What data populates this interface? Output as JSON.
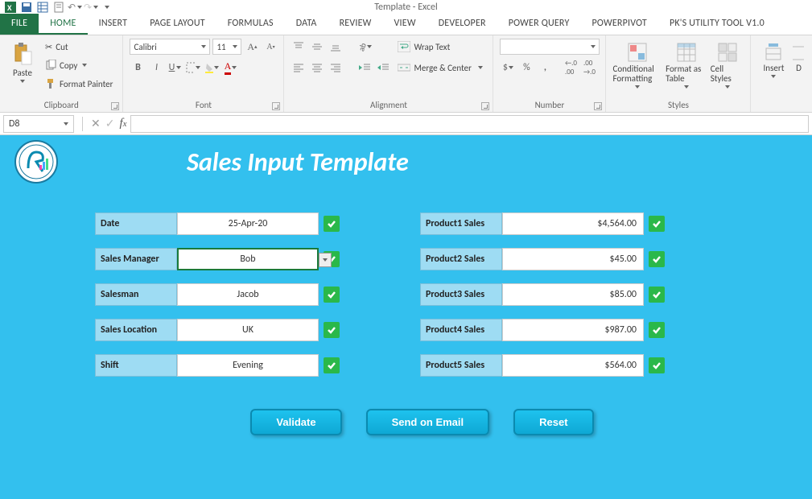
{
  "app": {
    "title": "Template - Excel"
  },
  "qat_icons": [
    "excel",
    "save",
    "table",
    "form",
    "undo",
    "redo"
  ],
  "tabs": [
    "FILE",
    "HOME",
    "INSERT",
    "PAGE LAYOUT",
    "FORMULAS",
    "DATA",
    "REVIEW",
    "VIEW",
    "DEVELOPER",
    "POWER QUERY",
    "POWERPIVOT",
    "PK's Utility Tool V1.0"
  ],
  "active_tab": "HOME",
  "ribbon": {
    "clipboard": {
      "paste": "Paste",
      "cut": "Cut",
      "copy": "Copy",
      "format_painter": "Format Painter",
      "label": "Clipboard"
    },
    "font": {
      "name": "Calibri",
      "size": "11",
      "label": "Font"
    },
    "alignment": {
      "wrap": "Wrap Text",
      "merge": "Merge & Center",
      "label": "Alignment"
    },
    "number": {
      "label": "Number"
    },
    "styles": {
      "cond": "Conditional Formatting",
      "fmt_table": "Format as Table",
      "cell_styles": "Cell Styles",
      "label": "Styles"
    },
    "cells": {
      "insert": "Insert",
      "delete": "D",
      "label": ""
    }
  },
  "formula_bar": {
    "cell_ref": "D8",
    "fx": ""
  },
  "sheet": {
    "title": "Sales Input Template",
    "left": [
      {
        "label": "Date",
        "value": "25-Apr-20",
        "check": true
      },
      {
        "label": "Sales Manager",
        "value": "Bob",
        "check": true,
        "selected": true,
        "dropdown": true
      },
      {
        "label": "Salesman",
        "value": "Jacob",
        "check": true
      },
      {
        "label": "Sales Location",
        "value": "UK",
        "check": true
      },
      {
        "label": "Shift",
        "value": "Evening",
        "check": true
      }
    ],
    "right": [
      {
        "label": "Product1 Sales",
        "value": "$4,564.00",
        "check": true
      },
      {
        "label": "Product2 Sales",
        "value": "$45.00",
        "check": true
      },
      {
        "label": "Product3 Sales",
        "value": "$85.00",
        "check": true
      },
      {
        "label": "Product4 Sales",
        "value": "$987.00",
        "check": true
      },
      {
        "label": "Product5 Sales",
        "value": "$564.00",
        "check": true
      }
    ],
    "buttons": {
      "validate": "Validate",
      "send": "Send on Email",
      "reset": "Reset"
    }
  },
  "colors": {
    "accent": "#217346",
    "sheet_bg": "#33c0ee",
    "label_bg": "#9edcf3",
    "check": "#2ab84a"
  }
}
